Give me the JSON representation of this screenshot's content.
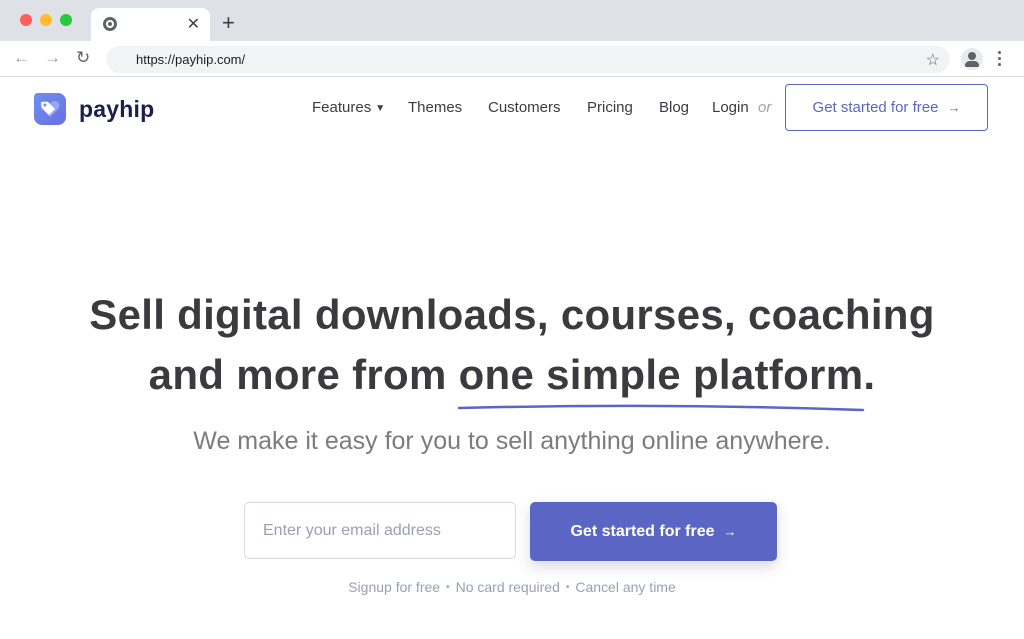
{
  "browser": {
    "tab_title": "",
    "url": "https://payhip.com/",
    "icons": {
      "close": "close-icon",
      "new_tab": "plus-icon",
      "back": "arrow-left-icon",
      "forward": "arrow-right-icon",
      "reload": "reload-icon",
      "bookmark": "star-icon",
      "profile": "profile-icon",
      "menu": "kebab-menu-icon"
    }
  },
  "header": {
    "logo_text": "payhip",
    "nav": {
      "features": "Features",
      "themes": "Themes",
      "customers": "Customers",
      "pricing": "Pricing",
      "blog": "Blog",
      "login": "Login",
      "or": "or"
    },
    "cta_label": "Get started for free",
    "cta_arrow": "→"
  },
  "hero": {
    "title_line1": "Sell digital downloads, courses, coaching",
    "title_line2_prefix": "and more from ",
    "title_line2_highlight": "one simple platform",
    "title_line2_suffix": ".",
    "subtitle": "We make it easy for you to sell anything online anywhere.",
    "email_placeholder": "Enter your email address",
    "email_value": "",
    "cta_label": "Get started for free",
    "cta_arrow": "→",
    "fineprint": [
      "Signup for free",
      "No card required",
      "Cancel any time"
    ]
  },
  "colors": {
    "brand": "#5b66c4",
    "logo_dark": "#1b1f4d",
    "heading": "#3a3a3f",
    "muted": "#9aa0b4"
  }
}
